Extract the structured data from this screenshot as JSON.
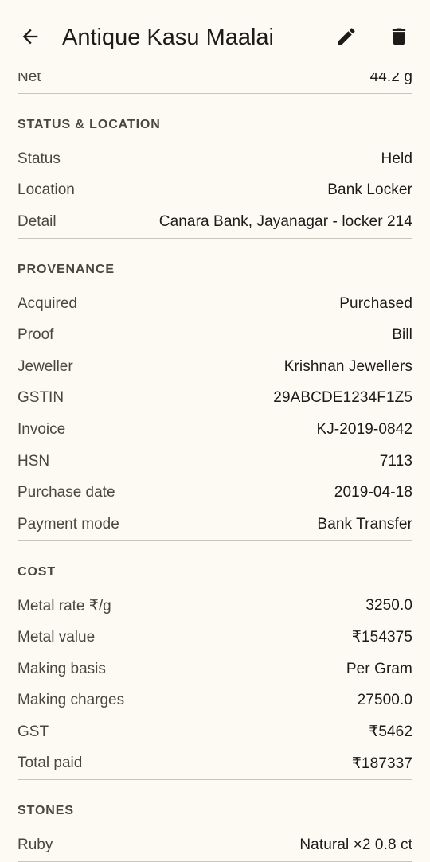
{
  "appbar": {
    "title": "Antique Kasu Maalai",
    "back_icon": "arrow-back-icon",
    "edit_icon": "pencil-icon",
    "delete_icon": "trash-icon"
  },
  "weight": {
    "rows": [
      {
        "label": "Net",
        "value": "44.2 g"
      }
    ]
  },
  "status_location": {
    "header": "STATUS & LOCATION",
    "rows": [
      {
        "label": "Status",
        "value": "Held"
      },
      {
        "label": "Location",
        "value": "Bank Locker"
      },
      {
        "label": "Detail",
        "value": "Canara Bank, Jayanagar - locker 214"
      }
    ]
  },
  "provenance": {
    "header": "PROVENANCE",
    "rows": [
      {
        "label": "Acquired",
        "value": "Purchased"
      },
      {
        "label": "Proof",
        "value": "Bill"
      },
      {
        "label": "Jeweller",
        "value": "Krishnan Jewellers"
      },
      {
        "label": "GSTIN",
        "value": "29ABCDE1234F1Z5"
      },
      {
        "label": "Invoice",
        "value": "KJ-2019-0842"
      },
      {
        "label": "HSN",
        "value": "7113"
      },
      {
        "label": "Purchase date",
        "value": "2019-04-18"
      },
      {
        "label": "Payment mode",
        "value": "Bank Transfer"
      }
    ]
  },
  "cost": {
    "header": "COST",
    "rows": [
      {
        "label": "Metal rate ₹/g",
        "value": "3250.0"
      },
      {
        "label": "Metal value",
        "value": "₹154375"
      },
      {
        "label": "Making basis",
        "value": "Per Gram"
      },
      {
        "label": "Making charges",
        "value": "27500.0"
      },
      {
        "label": "GST",
        "value": "₹5462"
      },
      {
        "label": "Total paid",
        "value": "₹187337"
      }
    ]
  },
  "stones": {
    "header": "STONES",
    "rows": [
      {
        "label": "Ruby",
        "value": "Natural ×2 0.8 ct"
      }
    ]
  },
  "colors": {
    "background": "#fdfaf3",
    "text_primary": "#1d1b18",
    "text_secondary": "#4a4741",
    "divider": "#c9c5bc"
  }
}
